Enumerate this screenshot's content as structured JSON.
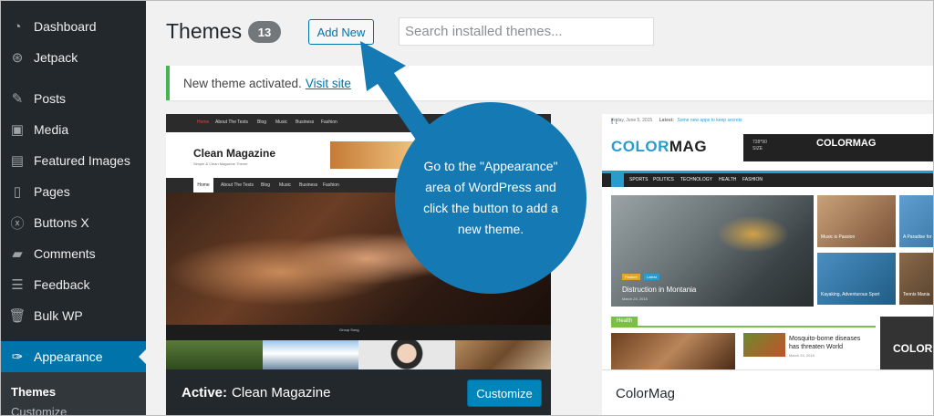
{
  "sidebar": {
    "items": [
      {
        "label": "Dashboard",
        "icon": "dashboard-icon"
      },
      {
        "label": "Jetpack",
        "icon": "jetpack-icon"
      },
      {
        "label": "Posts",
        "icon": "pin-icon"
      },
      {
        "label": "Media",
        "icon": "media-icon"
      },
      {
        "label": "Featured Images",
        "icon": "images-icon"
      },
      {
        "label": "Pages",
        "icon": "pages-icon"
      },
      {
        "label": "Buttons X",
        "icon": "x-icon"
      },
      {
        "label": "Comments",
        "icon": "comment-icon"
      },
      {
        "label": "Feedback",
        "icon": "feedback-icon"
      },
      {
        "label": "Bulk WP",
        "icon": "trash-icon"
      },
      {
        "label": "Appearance",
        "icon": "brush-icon"
      }
    ],
    "submenu": {
      "active": "Themes",
      "next": "Customize"
    }
  },
  "header": {
    "title": "Themes",
    "count": "13",
    "add_new": "Add New",
    "search_placeholder": "Search installed themes..."
  },
  "notice": {
    "text": "New theme activated.",
    "link": "Visit site"
  },
  "themes": [
    {
      "name": "Clean Magazine",
      "active_label": "Active:",
      "customize": "Customize",
      "preview": {
        "top_nav": [
          "Home",
          "About The Tests",
          "Blog",
          "Music",
          "Business",
          "Fashion"
        ],
        "logo": "Clean Magazine",
        "tagline": "Simple & Clean Magazine Theme",
        "bar_home": "Home",
        "bar_nav": [
          "About The Tests",
          "Blog",
          "Music",
          "Business",
          "Fashion"
        ],
        "photo_caption": "Group Song"
      }
    },
    {
      "name": "ColorMag",
      "preview": {
        "date": "Friday, June 5, 2015",
        "latest": "Latest:",
        "latest_text": "Some new apps to keep secrets",
        "logo_color": "COLOR",
        "logo_dark": "MAG",
        "ad_size": "728*90 SIZE",
        "ad_logo": "COLORMAG",
        "nav": [
          "SPORTS",
          "POLITICS",
          "TECHNOLOGY",
          "HEALTH",
          "FASHION"
        ],
        "big_title": "Distruction in Montania",
        "big_tag1": "Feature",
        "big_tag2": "Latest",
        "big_date": "March 24, 2015",
        "small": [
          "Music is Passion",
          "A Paradise for",
          "Kayaking, Adventurous Sport",
          "Tennis Mania"
        ],
        "section": "Health",
        "mosquito_title": "Mosquito-borne diseases has threaten World",
        "mosquito_date": "March 24, 2015",
        "square_logo": "COLOR"
      }
    }
  ],
  "callout": {
    "text": "Go to the \"Appearance\" area of WordPress and click the button to add a new theme."
  },
  "colors": {
    "sidebar_bg": "#23282d",
    "accent": "#0073aa",
    "callout": "#1579b4",
    "success": "#46b450"
  }
}
